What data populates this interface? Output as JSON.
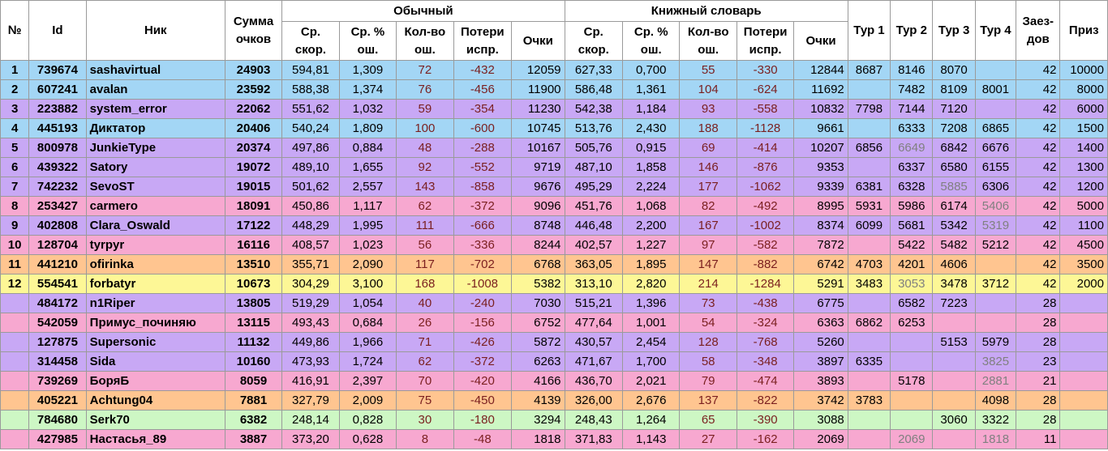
{
  "colors": {
    "blue": "#a3d6f5",
    "purple": "#c8a8f5",
    "pink": "#f7a8d0",
    "orange": "#ffc590",
    "yellow": "#fdf796",
    "green": "#cdf7c4",
    "stat_text": "#7a1f1f",
    "muted_text": "#808080"
  },
  "headers": {
    "num": "№",
    "id": "Id",
    "nick": "Ник",
    "sum": "Сумма очков",
    "group_normal": "Обычный",
    "group_book": "Книжный словарь",
    "speed": "Ср. скор.",
    "err_pct": "Ср. % ош.",
    "err_count": "Кол-во ош.",
    "loss": "Потери испр.",
    "points": "Очки",
    "tour1": "Тур 1",
    "tour2": "Тур 2",
    "tour3": "Тур 3",
    "tour4": "Тур 4",
    "races": "Заез-дов",
    "prize": "Приз"
  },
  "rows": [
    {
      "bg": "blue",
      "rank": "1",
      "id": "739674",
      "nick": "sashavirtual",
      "sum": "24903",
      "n_speed": "594,81",
      "n_errpct": "1,309",
      "n_errs": "72",
      "n_loss": "-432",
      "n_pts": "12059",
      "b_speed": "627,33",
      "b_errpct": "0,700",
      "b_errs": "55",
      "b_loss": "-330",
      "b_pts": "12844",
      "t1": "8687",
      "t2": "8146",
      "t3": "8070",
      "t4": "",
      "races": "42",
      "prize": "10000"
    },
    {
      "bg": "blue",
      "rank": "2",
      "id": "607241",
      "nick": "avalan",
      "sum": "23592",
      "n_speed": "588,38",
      "n_errpct": "1,374",
      "n_errs": "76",
      "n_loss": "-456",
      "n_pts": "11900",
      "b_speed": "586,48",
      "b_errpct": "1,361",
      "b_errs": "104",
      "b_loss": "-624",
      "b_pts": "11692",
      "t1": "",
      "t2": "7482",
      "t3": "8109",
      "t4": "8001",
      "races": "42",
      "prize": "8000"
    },
    {
      "bg": "purple",
      "rank": "3",
      "id": "223882",
      "nick": "system_error",
      "sum": "22062",
      "n_speed": "551,62",
      "n_errpct": "1,032",
      "n_errs": "59",
      "n_loss": "-354",
      "n_pts": "11230",
      "b_speed": "542,38",
      "b_errpct": "1,184",
      "b_errs": "93",
      "b_loss": "-558",
      "b_pts": "10832",
      "t1": "7798",
      "t2": "7144",
      "t3": "7120",
      "t4": "",
      "races": "42",
      "prize": "6000"
    },
    {
      "bg": "blue",
      "rank": "4",
      "id": "445193",
      "nick": "Диктатор",
      "sum": "20406",
      "n_speed": "540,24",
      "n_errpct": "1,809",
      "n_errs": "100",
      "n_loss": "-600",
      "n_pts": "10745",
      "b_speed": "513,76",
      "b_errpct": "2,430",
      "b_errs": "188",
      "b_loss": "-1128",
      "b_pts": "9661",
      "t1": "",
      "t2": "6333",
      "t3": "7208",
      "t4": "6865",
      "races": "42",
      "prize": "1500"
    },
    {
      "bg": "purple",
      "rank": "5",
      "id": "800978",
      "nick": "JunkieType",
      "sum": "20374",
      "n_speed": "497,86",
      "n_errpct": "0,884",
      "n_errs": "48",
      "n_loss": "-288",
      "n_pts": "10167",
      "b_speed": "505,76",
      "b_errpct": "0,915",
      "b_errs": "69",
      "b_loss": "-414",
      "b_pts": "10207",
      "t1": "6856",
      "t2": "6649",
      "t2_grey": true,
      "t3": "6842",
      "t4": "6676",
      "races": "42",
      "prize": "1400"
    },
    {
      "bg": "purple",
      "rank": "6",
      "id": "439322",
      "nick": "Satory",
      "sum": "19072",
      "n_speed": "489,10",
      "n_errpct": "1,655",
      "n_errs": "92",
      "n_loss": "-552",
      "n_pts": "9719",
      "b_speed": "487,10",
      "b_errpct": "1,858",
      "b_errs": "146",
      "b_loss": "-876",
      "b_pts": "9353",
      "t1": "",
      "t2": "6337",
      "t3": "6580",
      "t4": "6155",
      "races": "42",
      "prize": "1300"
    },
    {
      "bg": "purple",
      "rank": "7",
      "id": "742232",
      "nick": "SevoST",
      "sum": "19015",
      "n_speed": "501,62",
      "n_errpct": "2,557",
      "n_errs": "143",
      "n_loss": "-858",
      "n_pts": "9676",
      "b_speed": "495,29",
      "b_errpct": "2,224",
      "b_errs": "177",
      "b_loss": "-1062",
      "b_pts": "9339",
      "t1": "6381",
      "t2": "6328",
      "t3": "5885",
      "t3_grey": true,
      "t4": "6306",
      "races": "42",
      "prize": "1200"
    },
    {
      "bg": "pink",
      "rank": "8",
      "id": "253427",
      "nick": "carmero",
      "sum": "18091",
      "n_speed": "450,86",
      "n_errpct": "1,117",
      "n_errs": "62",
      "n_loss": "-372",
      "n_pts": "9096",
      "b_speed": "451,76",
      "b_errpct": "1,068",
      "b_errs": "82",
      "b_loss": "-492",
      "b_pts": "8995",
      "t1": "5931",
      "t2": "5986",
      "t3": "6174",
      "t4": "5406",
      "t4_grey": true,
      "races": "42",
      "prize": "5000"
    },
    {
      "bg": "purple",
      "rank": "9",
      "id": "402808",
      "nick": "Clara_Oswald",
      "sum": "17122",
      "n_speed": "448,29",
      "n_errpct": "1,995",
      "n_errs": "111",
      "n_loss": "-666",
      "n_pts": "8748",
      "b_speed": "446,48",
      "b_errpct": "2,200",
      "b_errs": "167",
      "b_loss": "-1002",
      "b_pts": "8374",
      "t1": "6099",
      "t2": "5681",
      "t3": "5342",
      "t4": "5319",
      "t4_grey": true,
      "races": "42",
      "prize": "1100"
    },
    {
      "bg": "pink",
      "rank": "10",
      "id": "128704",
      "nick": "tyrpyr",
      "sum": "16116",
      "n_speed": "408,57",
      "n_errpct": "1,023",
      "n_errs": "56",
      "n_loss": "-336",
      "n_pts": "8244",
      "b_speed": "402,57",
      "b_errpct": "1,227",
      "b_errs": "97",
      "b_loss": "-582",
      "b_pts": "7872",
      "t1": "",
      "t2": "5422",
      "t3": "5482",
      "t4": "5212",
      "races": "42",
      "prize": "4500"
    },
    {
      "bg": "orange",
      "rank": "11",
      "id": "441210",
      "nick": "ofirinka",
      "sum": "13510",
      "n_speed": "355,71",
      "n_errpct": "2,090",
      "n_errs": "117",
      "n_loss": "-702",
      "n_pts": "6768",
      "b_speed": "363,05",
      "b_errpct": "1,895",
      "b_errs": "147",
      "b_loss": "-882",
      "b_pts": "6742",
      "t1": "4703",
      "t2": "4201",
      "t3": "4606",
      "t4": "",
      "races": "42",
      "prize": "3500"
    },
    {
      "bg": "yellow",
      "rank": "12",
      "id": "554541",
      "nick": "forbatyr",
      "sum": "10673",
      "n_speed": "304,29",
      "n_errpct": "3,100",
      "n_errs": "168",
      "n_loss": "-1008",
      "n_pts": "5382",
      "b_speed": "313,10",
      "b_errpct": "2,820",
      "b_errs": "214",
      "b_loss": "-1284",
      "b_pts": "5291",
      "t1": "3483",
      "t2": "3053",
      "t2_grey": true,
      "t3": "3478",
      "t4": "3712",
      "races": "42",
      "prize": "2000"
    },
    {
      "bg": "purple",
      "rank": "",
      "id": "484172",
      "nick": "n1Riper",
      "sum": "13805",
      "n_speed": "519,29",
      "n_errpct": "1,054",
      "n_errs": "40",
      "n_loss": "-240",
      "n_pts": "7030",
      "b_speed": "515,21",
      "b_errpct": "1,396",
      "b_errs": "73",
      "b_loss": "-438",
      "b_pts": "6775",
      "t1": "",
      "t2": "6582",
      "t3": "7223",
      "t4": "",
      "races": "28",
      "prize": ""
    },
    {
      "bg": "pink",
      "rank": "",
      "id": "542059",
      "nick": "Примус_починяю",
      "sum": "13115",
      "n_speed": "493,43",
      "n_errpct": "0,684",
      "n_errs": "26",
      "n_loss": "-156",
      "n_pts": "6752",
      "b_speed": "477,64",
      "b_errpct": "1,001",
      "b_errs": "54",
      "b_loss": "-324",
      "b_pts": "6363",
      "t1": "6862",
      "t2": "6253",
      "t3": "",
      "t4": "",
      "races": "28",
      "prize": ""
    },
    {
      "bg": "purple",
      "rank": "",
      "id": "127875",
      "nick": "Supersonic",
      "sum": "11132",
      "n_speed": "449,86",
      "n_errpct": "1,966",
      "n_errs": "71",
      "n_loss": "-426",
      "n_pts": "5872",
      "b_speed": "430,57",
      "b_errpct": "2,454",
      "b_errs": "128",
      "b_loss": "-768",
      "b_pts": "5260",
      "t1": "",
      "t2": "",
      "t3": "5153",
      "t4": "5979",
      "races": "28",
      "prize": ""
    },
    {
      "bg": "purple",
      "rank": "",
      "id": "314458",
      "nick": "Sida",
      "sum": "10160",
      "n_speed": "473,93",
      "n_errpct": "1,724",
      "n_errs": "62",
      "n_loss": "-372",
      "n_pts": "6263",
      "b_speed": "471,67",
      "b_errpct": "1,700",
      "b_errs": "58",
      "b_loss": "-348",
      "b_pts": "3897",
      "t1": "6335",
      "t2": "",
      "t3": "",
      "t4": "3825",
      "t4_grey": true,
      "races": "23",
      "prize": ""
    },
    {
      "bg": "pink",
      "rank": "",
      "id": "739269",
      "nick": "БоряБ",
      "sum": "8059",
      "n_speed": "416,91",
      "n_errpct": "2,397",
      "n_errs": "70",
      "n_loss": "-420",
      "n_pts": "4166",
      "b_speed": "436,70",
      "b_errpct": "2,021",
      "b_errs": "79",
      "b_loss": "-474",
      "b_pts": "3893",
      "t1": "",
      "t2": "5178",
      "t3": "",
      "t4": "2881",
      "t4_grey": true,
      "races": "21",
      "prize": ""
    },
    {
      "bg": "orange",
      "rank": "",
      "id": "405221",
      "nick": "Achtung04",
      "sum": "7881",
      "n_speed": "327,79",
      "n_errpct": "2,009",
      "n_errs": "75",
      "n_loss": "-450",
      "n_pts": "4139",
      "b_speed": "326,00",
      "b_errpct": "2,676",
      "b_errs": "137",
      "b_loss": "-822",
      "b_pts": "3742",
      "t1": "3783",
      "t2": "",
      "t3": "",
      "t4": "4098",
      "races": "28",
      "prize": ""
    },
    {
      "bg": "green",
      "rank": "",
      "id": "784680",
      "nick": "Serk70",
      "sum": "6382",
      "n_speed": "248,14",
      "n_errpct": "0,828",
      "n_errs": "30",
      "n_loss": "-180",
      "n_pts": "3294",
      "b_speed": "248,43",
      "b_errpct": "1,264",
      "b_errs": "65",
      "b_loss": "-390",
      "b_pts": "3088",
      "t1": "",
      "t2": "",
      "t3": "3060",
      "t4": "3322",
      "races": "28",
      "prize": ""
    },
    {
      "bg": "pink",
      "rank": "",
      "id": "427985",
      "nick": "Настасья_89",
      "sum": "3887",
      "n_speed": "373,20",
      "n_errpct": "0,628",
      "n_errs": "8",
      "n_loss": "-48",
      "n_pts": "1818",
      "b_speed": "371,83",
      "b_errpct": "1,143",
      "b_errs": "27",
      "b_loss": "-162",
      "b_pts": "2069",
      "t1": "",
      "t2": "2069",
      "t2_grey": true,
      "t3": "",
      "t4": "1818",
      "t4_grey": true,
      "races": "11",
      "prize": ""
    }
  ]
}
